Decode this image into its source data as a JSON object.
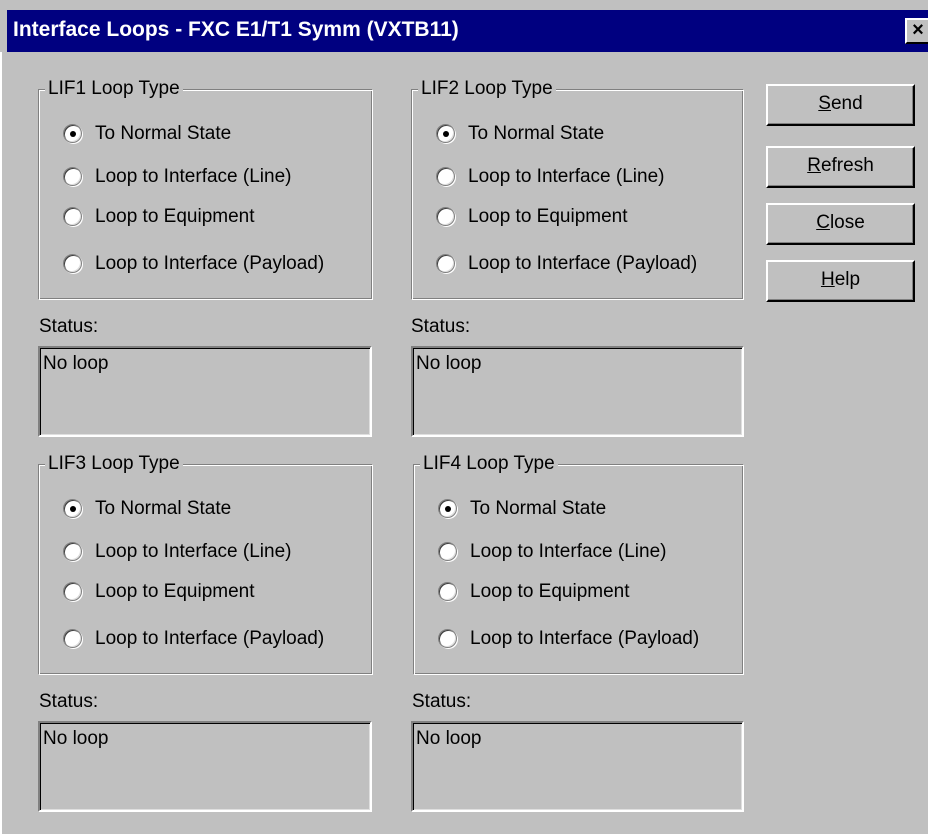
{
  "window": {
    "title": "Interface Loops - FXC E1/T1 Symm (VXTB11)",
    "close_glyph": "×"
  },
  "groups": [
    {
      "legend": "LIF1 Loop Type",
      "options": [
        "To Normal State",
        "Loop to Interface (Line)",
        "Loop to Equipment",
        "Loop to Interface (Payload)"
      ],
      "selected": 0,
      "status_label": "Status:",
      "status_value": "No loop"
    },
    {
      "legend": "LIF2 Loop Type",
      "options": [
        "To Normal State",
        "Loop to Interface (Line)",
        "Loop to Equipment",
        "Loop to Interface (Payload)"
      ],
      "selected": 0,
      "status_label": "Status:",
      "status_value": "No loop"
    },
    {
      "legend": "LIF3 Loop Type",
      "options": [
        "To Normal State",
        "Loop to Interface (Line)",
        "Loop to Equipment",
        "Loop to Interface (Payload)"
      ],
      "selected": 0,
      "status_label": "Status:",
      "status_value": "No loop"
    },
    {
      "legend": "LIF4 Loop Type",
      "options": [
        "To Normal State",
        "Loop to Interface (Line)",
        "Loop to Equipment",
        "Loop to Interface (Payload)"
      ],
      "selected": 0,
      "status_label": "Status:",
      "status_value": "No loop"
    }
  ],
  "buttons": [
    {
      "label": "Send",
      "mnemonic": "S",
      "rest": "end"
    },
    {
      "label": "Refresh",
      "mnemonic": "R",
      "rest": "efresh"
    },
    {
      "label": "Close",
      "mnemonic": "C",
      "rest": "lose"
    },
    {
      "label": "Help",
      "mnemonic": "H",
      "rest": "elp"
    }
  ],
  "colors": {
    "titlebar": "#000080",
    "face": "#c0c0c0"
  }
}
